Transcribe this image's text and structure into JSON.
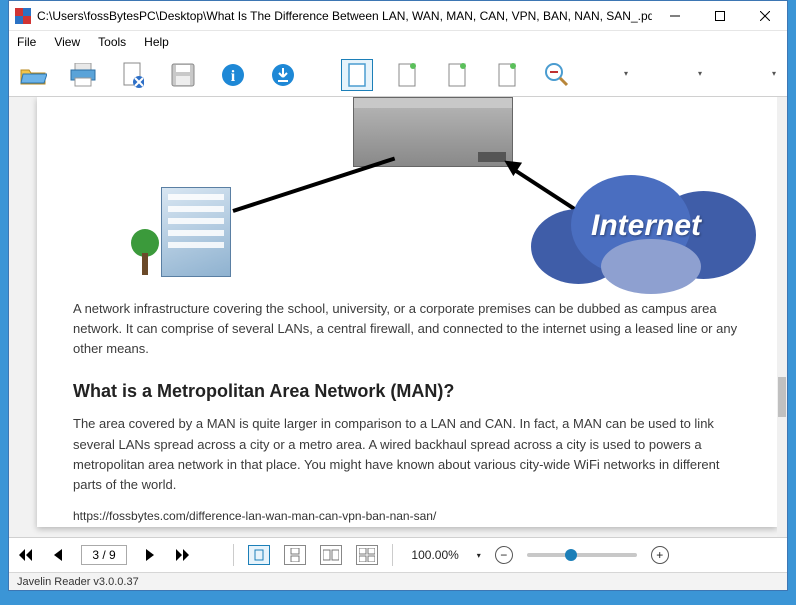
{
  "titlebar": {
    "path": "C:\\Users\\fossBytesPC\\Desktop\\What Is The Difference Between LAN, WAN, MAN, CAN, VPN, BAN, NAN, SAN_.pdf"
  },
  "menu": {
    "file": "File",
    "view": "View",
    "tools": "Tools",
    "help": "Help"
  },
  "toolbar": {
    "open": "open-icon",
    "print": "print-icon",
    "remove": "remove-page-icon",
    "save": "save-icon",
    "info": "info-icon",
    "download": "download-icon",
    "fit_page": "fit-page-icon",
    "fit_width": "fit-width-icon",
    "rotate_left": "rotate-left-icon",
    "rotate_right": "rotate-right-icon",
    "zoom": "zoom-icon"
  },
  "document": {
    "cloud_label": "Internet",
    "para1": "A network infrastructure covering the school, university, or a corporate premises can be dubbed as campus area network. It can comprise of several LANs, a central firewall, and connected to the internet using a leased line or any other means.",
    "heading": "What is a Metropolitan Area Network (MAN)?",
    "para2": "The area covered by a MAN is quite larger in comparison to a LAN and CAN. In fact, a MAN can be used to link several LANs spread across a city or a metro area. A wired backhaul spread across a city is used to powers a metropolitan area network in that place. You might have known about various city-wide WiFi networks in different parts of the world.",
    "source_url": "https://fossbytes.com/difference-lan-wan-man-can-vpn-ban-nan-san/"
  },
  "nav": {
    "page_display": "3 / 9",
    "zoom_display": "100.00%"
  },
  "status": {
    "text": "Javelin Reader v3.0.0.37"
  }
}
